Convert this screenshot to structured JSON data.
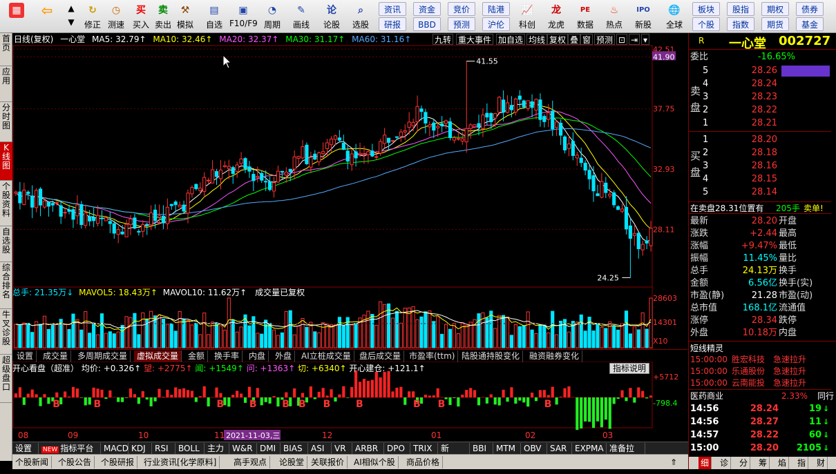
{
  "toolbar": {
    "items": [
      {
        "label": "",
        "icon": "grid-icon"
      },
      {
        "label": "",
        "icon": "back-arrow-icon"
      },
      {
        "label": "修正",
        "icon": "refresh-icon"
      },
      {
        "label": "测速",
        "icon": "clock-icon"
      },
      {
        "label": "买入",
        "icon": "buy-icon",
        "glyph": "买"
      },
      {
        "label": "卖出",
        "icon": "sell-icon",
        "glyph": "卖"
      },
      {
        "label": "模拟",
        "icon": "hammer-icon"
      },
      {
        "label": "自选",
        "icon": "watchlist-icon"
      },
      {
        "label": "F10/F9",
        "icon": "f10-icon"
      },
      {
        "label": "周期",
        "icon": "period-icon"
      },
      {
        "label": "画线",
        "icon": "pencil-icon"
      },
      {
        "label": "论股",
        "icon": "forum-icon"
      },
      {
        "label": "选股",
        "icon": "stock-picker-icon"
      }
    ],
    "small_buttons_row1": [
      "资讯",
      "资金",
      "竞价",
      "陆港"
    ],
    "small_buttons_row2": [
      "研报",
      "BBD",
      "预测",
      "沪伦"
    ],
    "items2": [
      {
        "label": "科创",
        "icon": "chart-icon"
      },
      {
        "label": "龙虎",
        "icon": "dragon-tiger-icon"
      },
      {
        "label": "数据",
        "icon": "pe-icon"
      },
      {
        "label": "热点",
        "icon": "hot-icon"
      },
      {
        "label": "新股",
        "icon": "ipo-icon"
      },
      {
        "label": "全球",
        "icon": "globe-icon"
      }
    ],
    "small_buttons_right1": [
      "板块",
      "股指",
      "期权",
      "债券"
    ],
    "small_buttons_right2": [
      "个股",
      "指数",
      "期货",
      "基金"
    ]
  },
  "left_tabs": [
    "首页",
    "应用",
    "分时图",
    "K线图",
    "个股资料",
    "自选股",
    "综合排名",
    "牛叉诊股",
    "超级盘口"
  ],
  "kline": {
    "header": {
      "title": "日线(复权)",
      "name": "一心堂",
      "ma5": "MA5: 32.79↑",
      "ma10": "MA10: 32.46↑",
      "ma20": "MA20: 32.37↑",
      "ma30": "MA30: 31.17↑",
      "ma60": "MA60: 31.16↑"
    },
    "header_buttons": [
      "九转",
      "重大事件",
      "加自选",
      "均线",
      "复权",
      "叠",
      "窗",
      "预测"
    ],
    "price_labels": [
      "42.51",
      "41.90",
      "37.75",
      "32.93",
      "28.11"
    ],
    "high_label": "41.55",
    "low_label": "24.25",
    "volume_header": {
      "total": "总手: 21.35万↓",
      "mavol5": "MAVOL5: 18.43万↑",
      "mavol10": "MAVOL10: 11.62万↑",
      "note": "成交量已复权"
    },
    "volume_labels": [
      "28603",
      "14301",
      "X10"
    ],
    "pane_tabs": [
      "设置",
      "成交量",
      "多周期成交量",
      "虚拟成交量",
      "金额",
      "换手率",
      "内盘",
      "外盘",
      "AI立桩成交量",
      "盘后成交量",
      "市盈率(ttm)",
      "陆股通持股变化",
      "融资融券变化"
    ],
    "indicator_header": {
      "name": "开心看盘（超准）",
      "junjia": "均价: +0.326↑",
      "wang": "望: +2775↑",
      "wen": "闻: +1549↑",
      "wen2": "问: +1363↑",
      "qie": "切: +6340↑",
      "kaixin": "开心建仓: +121.1↑",
      "explain_btn": "指标说明"
    },
    "indicator_labels": [
      "+5712",
      "-798.4"
    ],
    "x_labels": [
      "08",
      "09",
      "10",
      "11",
      "12",
      "01",
      "02",
      "03"
    ],
    "x_highlight": "2021-11-03,三"
  },
  "indicator_bar": [
    "设置",
    "指标平台",
    "MACD",
    "KDJ",
    "RSI",
    "BOLL",
    "主力",
    "W&R",
    "DMI",
    "BIAS",
    "ASI",
    "VR",
    "ARBR",
    "DPO",
    "TRIX",
    "新DMA",
    "BBI",
    "MTM",
    "OBV",
    "SAR",
    "EXPMA",
    "准备拉升"
  ],
  "new_badge": "NEW",
  "bottom_tabs": [
    "个股新闻",
    "个股公告",
    "个股研报",
    "行业资讯[化学原料]",
    "高手观点",
    "论股堂",
    "关联报价",
    "AI相似个股",
    "商品价格"
  ],
  "quote": {
    "r_label": "R",
    "name": "一心堂",
    "code": "002727",
    "weibi_label": "委比",
    "weibi": "-16.65%",
    "sell_label": "卖盘",
    "buy_label": "买盘",
    "sell": [
      {
        "level": "5",
        "price": "28.26"
      },
      {
        "level": "4",
        "price": "28.24"
      },
      {
        "level": "3",
        "price": "28.23"
      },
      {
        "level": "2",
        "price": "28.22"
      },
      {
        "level": "1",
        "price": "28.21"
      }
    ],
    "buy": [
      {
        "level": "1",
        "price": "28.20"
      },
      {
        "level": "2",
        "price": "28.18"
      },
      {
        "level": "3",
        "price": "28.16"
      },
      {
        "level": "4",
        "price": "28.15"
      },
      {
        "level": "5",
        "price": "28.14"
      }
    ],
    "notice": {
      "text": "在卖盘28.31位置有",
      "qty": "205手",
      "action": "卖单!"
    },
    "stats": [
      {
        "l1": "最新",
        "v1": "28.20",
        "c1": "red",
        "l2": "开盘"
      },
      {
        "l1": "涨跌",
        "v1": "+2.44",
        "c1": "red",
        "l2": "最高"
      },
      {
        "l1": "涨幅",
        "v1": "+9.47%",
        "c1": "red",
        "l2": "最低"
      },
      {
        "l1": "振幅",
        "v1": "11.45%",
        "c1": "cyan",
        "l2": "量比"
      },
      {
        "l1": "总手",
        "v1": "24.13万",
        "c1": "yellow",
        "l2": "换手"
      },
      {
        "l1": "金额",
        "v1": "6.56亿",
        "c1": "cyan",
        "l2": "换手(实)"
      },
      {
        "l1": "市盈(静)",
        "v1": "21.28",
        "c1": "white",
        "l2": "市盈(动)"
      },
      {
        "l1": "总市值",
        "v1": "168.1亿",
        "c1": "cyan",
        "l2": "流通值"
      },
      {
        "l1": "涨停",
        "v1": "28.34",
        "c1": "red",
        "l2": "跌停"
      },
      {
        "l1": "外盘",
        "v1": "10.18万",
        "c1": "red",
        "l2": "内盘"
      }
    ],
    "short_title": "短线精灵",
    "short_items": [
      {
        "time": "15:00:00",
        "name": "胜宏科技",
        "event": "急速拉升"
      },
      {
        "time": "15:00:00",
        "name": "乐通股份",
        "event": "急速拉升"
      },
      {
        "time": "15:00:00",
        "name": "云南能投",
        "event": "急速拉升"
      }
    ],
    "sector": {
      "name": "医药商业",
      "change": "2.33%",
      "extra": "同行"
    },
    "ticks": [
      {
        "time": "14:56",
        "price": "28.24",
        "vol": "19",
        "dir": "down"
      },
      {
        "time": "14:56",
        "price": "28.27",
        "vol": "11",
        "dir": "down"
      },
      {
        "time": "14:57",
        "price": "28.22",
        "vol": "60",
        "dir": "down"
      },
      {
        "time": "15:00",
        "price": "28.20",
        "vol": "2105",
        "dir": "down"
      }
    ],
    "right_tabs": [
      "细",
      "诊",
      "分",
      "筹",
      "焰",
      "指",
      "财"
    ]
  },
  "colors": {
    "up": "#ff3333",
    "down": "#00e5ff",
    "ma5": "#ffffff",
    "ma10": "#ffff00",
    "ma20": "#ff55ff",
    "ma30": "#00ff00",
    "ma60": "#55aaff"
  }
}
